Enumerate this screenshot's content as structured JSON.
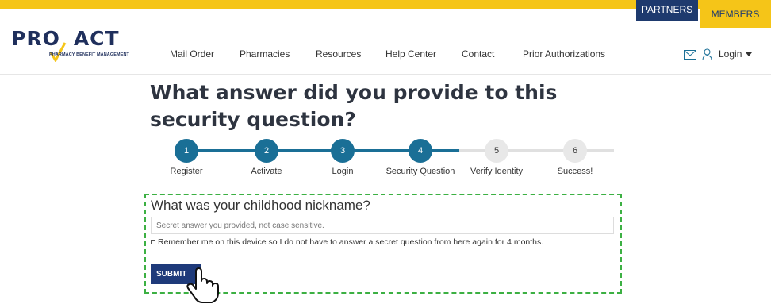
{
  "topbar": {
    "partners_label": "PARTNERS",
    "members_label": "MEMBERS"
  },
  "logo": {
    "main_text": "PRO ACT",
    "sub_text": "PHARMACY BENEFIT MANAGEMENT",
    "accent": "#f5c518",
    "brand": "#1f2f5c"
  },
  "nav": {
    "items": [
      "Mail Order",
      "Pharmacies",
      "Resources",
      "Help Center",
      "Contact",
      "Prior Authorizations"
    ]
  },
  "header_right": {
    "mail_icon": "envelope-icon",
    "user_icon": "user-icon",
    "login_label": "Login"
  },
  "page": {
    "title": "What answer did you provide to this security question?"
  },
  "stepper": {
    "active_color": "#1a6f96",
    "steps": [
      {
        "number": "1",
        "label": "Register",
        "done": true
      },
      {
        "number": "2",
        "label": "Activate",
        "done": true
      },
      {
        "number": "3",
        "label": "Login",
        "done": true
      },
      {
        "number": "4",
        "label": "Security Question",
        "done": true
      },
      {
        "number": "5",
        "label": "Verify Identity",
        "done": false
      },
      {
        "number": "6",
        "label": "Success!",
        "done": false
      }
    ]
  },
  "form": {
    "question": "What was your childhood nickname?",
    "answer_placeholder": "Secret answer you provided, not case sensitive.",
    "answer_value": "",
    "remember_label": "Remember me on this device so I do not have to answer a secret question from here again for 4 months.",
    "remember_checked": false,
    "submit_label": "SUBMIT",
    "highlight_color": "#3cb043"
  }
}
